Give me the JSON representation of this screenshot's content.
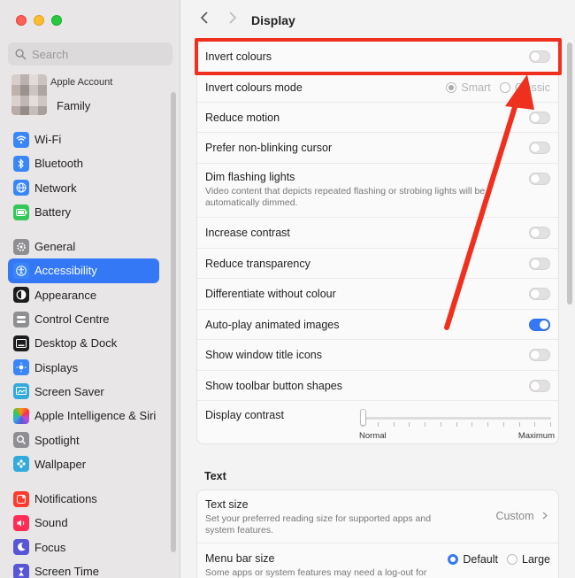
{
  "sidebar": {
    "search_placeholder": "Search",
    "account_label": "Apple Account",
    "family_label": "Family",
    "group1": [
      {
        "label": "Wi-Fi",
        "icon": "wifi-icon"
      },
      {
        "label": "Bluetooth",
        "icon": "bluetooth-icon"
      },
      {
        "label": "Network",
        "icon": "network-icon"
      },
      {
        "label": "Battery",
        "icon": "battery-icon"
      }
    ],
    "group2": [
      {
        "label": "General",
        "icon": "gear-icon"
      },
      {
        "label": "Accessibility",
        "icon": "accessibility-icon",
        "selected": true
      },
      {
        "label": "Appearance",
        "icon": "appearance-icon"
      },
      {
        "label": "Control Centre",
        "icon": "control-centre-icon"
      },
      {
        "label": "Desktop & Dock",
        "icon": "desktop-dock-icon"
      },
      {
        "label": "Displays",
        "icon": "displays-icon"
      },
      {
        "label": "Screen Saver",
        "icon": "screen-saver-icon"
      },
      {
        "label": "Apple Intelligence & Siri",
        "icon": "siri-icon"
      },
      {
        "label": "Spotlight",
        "icon": "spotlight-icon"
      },
      {
        "label": "Wallpaper",
        "icon": "wallpaper-icon"
      }
    ],
    "group3": [
      {
        "label": "Notifications",
        "icon": "notifications-icon"
      },
      {
        "label": "Sound",
        "icon": "sound-icon"
      },
      {
        "label": "Focus",
        "icon": "focus-icon"
      },
      {
        "label": "Screen Time",
        "icon": "screen-time-icon"
      }
    ]
  },
  "header": {
    "title": "Display"
  },
  "display": {
    "invert_colours": "Invert colours",
    "invert_colours_mode": "Invert colours mode",
    "mode_smart": "Smart",
    "mode_classic": "Classic",
    "reduce_motion": "Reduce motion",
    "prefer_non_blinking": "Prefer non-blinking cursor",
    "dim_flashing": "Dim flashing lights",
    "dim_flashing_desc": "Video content that depicts repeated flashing or strobing lights will be automatically dimmed.",
    "increase_contrast": "Increase contrast",
    "reduce_transparency": "Reduce transparency",
    "differentiate": "Differentiate without colour",
    "autoplay": "Auto-play animated images",
    "window_title_icons": "Show window title icons",
    "toolbar_shapes": "Show toolbar button shapes",
    "display_contrast": "Display contrast",
    "contrast_min": "Normal",
    "contrast_max": "Maximum",
    "contrast_level": 0
  },
  "text_section": {
    "title": "Text",
    "text_size": "Text size",
    "text_size_desc": "Set your preferred reading size for supported apps and system features.",
    "text_size_value": "Custom",
    "menu_bar_size": "Menu bar size",
    "menu_bar_desc": "Some apps or system features may need a log-out for",
    "menu_default": "Default",
    "menu_large": "Large"
  },
  "colors": {
    "accent": "#3478f6",
    "annotation": "#f0301e"
  }
}
